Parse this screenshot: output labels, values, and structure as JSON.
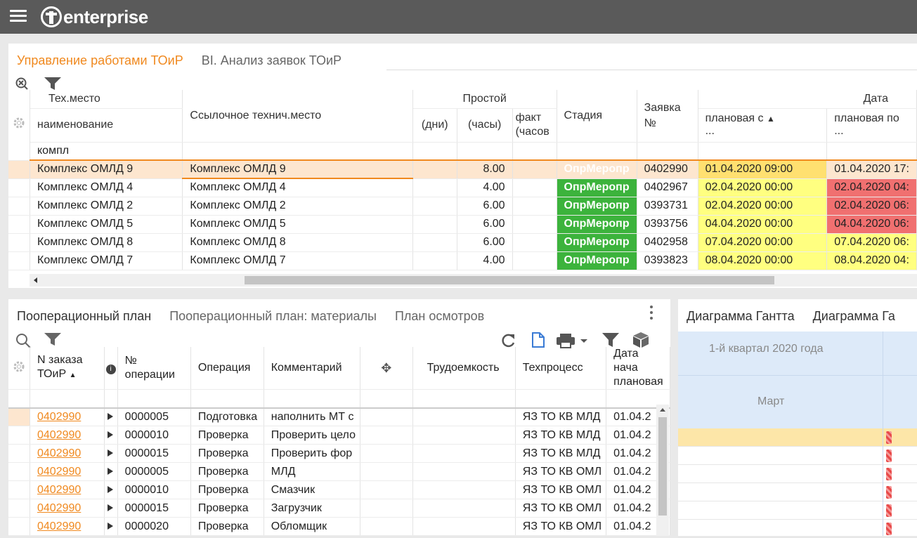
{
  "app": {
    "logo_text": "enterprise"
  },
  "top_panel": {
    "tabs": [
      "Управление работами ТОиР",
      "BI. Анализ заявок ТОиР"
    ],
    "headers": {
      "tech_place": "Тех.место",
      "name": "наименование",
      "filter_value": "компл",
      "ref_place": "Ссылочное технич.место",
      "downtime": "Простой",
      "days": "(дни)",
      "hours": "(часы)",
      "fact": "факт (часов",
      "stage": "Стадия",
      "request_no": "Заявка №",
      "date": "Дата",
      "planned_from": "плановая с",
      "planned_to": "плановая по",
      "ellipsis": "..."
    },
    "rows": [
      {
        "name": "Комплекс ОМЛД 9",
        "ref": "Комплекс ОМЛД 9",
        "hours": "8.00",
        "stage": "ОпрМеропр",
        "req": "0402990",
        "from": "01.04.2020 09:00",
        "to": "01.04.2020 17:"
      },
      {
        "name": "Комплекс ОМЛД 4",
        "ref": "Комплекс ОМЛД 4",
        "hours": "4.00",
        "stage": "ОпрМеропр",
        "req": "0402967",
        "from": "02.04.2020 00:00",
        "to": "02.04.2020 04:"
      },
      {
        "name": "Комплекс ОМЛД 2",
        "ref": "Комплекс ОМЛД 2",
        "hours": "6.00",
        "stage": "ОпрМеропр",
        "req": "0393731",
        "from": "02.04.2020 00:00",
        "to": "02.04.2020 06:"
      },
      {
        "name": "Комплекс ОМЛД 5",
        "ref": "Комплекс ОМЛД 5",
        "hours": "6.00",
        "stage": "ОпрМеропр",
        "req": "0393756",
        "from": "04.04.2020 00:00",
        "to": "04.04.2020 06:"
      },
      {
        "name": "Комплекс ОМЛД 8",
        "ref": "Комплекс ОМЛД 8",
        "hours": "6.00",
        "stage": "ОпрМеропр",
        "req": "0402958",
        "from": "07.04.2020 00:00",
        "to": "07.04.2020 06:"
      },
      {
        "name": "Комплекс ОМЛД 7",
        "ref": "Комплекс ОМЛД 7",
        "hours": "4.00",
        "stage": "ОпрМеропр",
        "req": "0393823",
        "from": "08.04.2020 00:00",
        "to": "08.04.2020 04:"
      }
    ]
  },
  "bottom_left": {
    "tabs": [
      "Пооперационный план",
      "Пооперационный план: материалы",
      "План осмотров"
    ],
    "headers": {
      "order": "N заказа ТОиР",
      "op_no": "№ операции",
      "operation": "Операция",
      "comment": "Комментарий",
      "labor": "Трудоемкость",
      "process": "Техпроцесс",
      "start_date": "Дата нача плановая"
    },
    "rows": [
      {
        "order": "0402990",
        "op_no": "0000005",
        "operation": "Подготовка",
        "comment": "наполнить МТ с",
        "process": "ЯЗ ТО КВ МЛД",
        "date": "01.04.2"
      },
      {
        "order": "0402990",
        "op_no": "0000010",
        "operation": "Проверка",
        "comment": "Проверить цело",
        "process": "ЯЗ ТО КВ МЛД",
        "date": "01.04.2"
      },
      {
        "order": "0402990",
        "op_no": "0000015",
        "operation": "Проверка",
        "comment": "Проверить фор",
        "process": "ЯЗ ТО КВ МЛД",
        "date": "01.04.2"
      },
      {
        "order": "0402990",
        "op_no": "0000005",
        "operation": "Проверка",
        "comment": "МЛД",
        "process": "ЯЗ ТО КВ ОМЛ",
        "date": "01.04.2"
      },
      {
        "order": "0402990",
        "op_no": "0000010",
        "operation": "Проверка",
        "comment": "Смазчик",
        "process": "ЯЗ ТО КВ ОМЛ",
        "date": "01.04.2"
      },
      {
        "order": "0402990",
        "op_no": "0000015",
        "operation": "Проверка",
        "comment": "Загрузчик",
        "process": "ЯЗ ТО КВ ОМЛ",
        "date": "01.04.2"
      },
      {
        "order": "0402990",
        "op_no": "0000020",
        "operation": "Проверка",
        "comment": "Обломщик",
        "process": "ЯЗ ТО КВ ОМЛ",
        "date": "01.04.2"
      }
    ]
  },
  "gantt": {
    "tabs": [
      "Диаграмма Гантта",
      "Диаграмма Га"
    ],
    "quarter": "1-й квартал 2020 года",
    "month": "Март"
  }
}
